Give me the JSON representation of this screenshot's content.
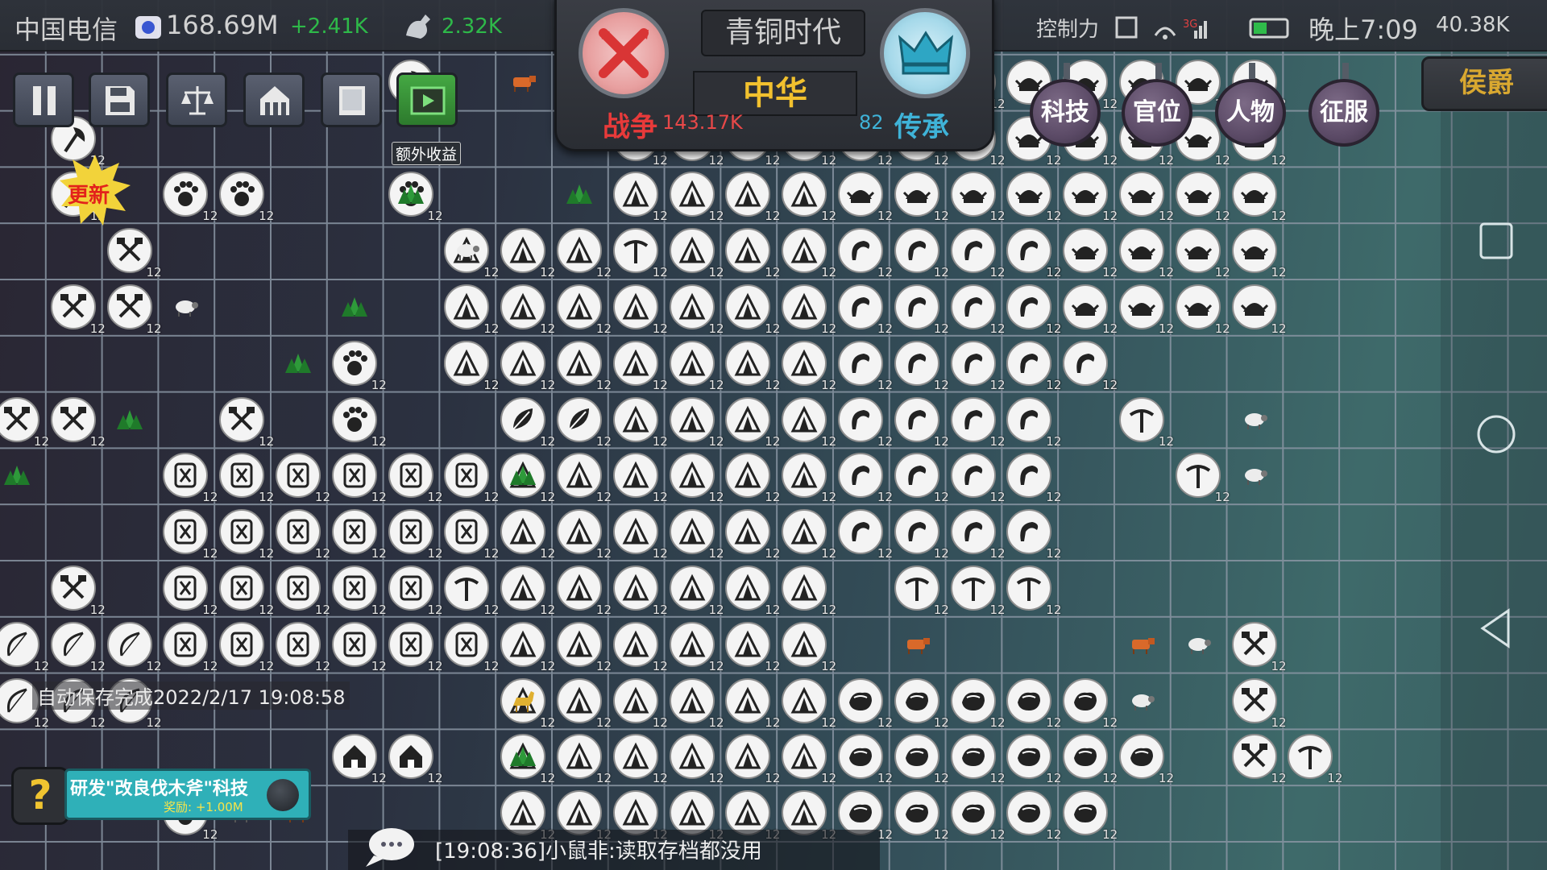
{
  "status_bar": {
    "carrier": "中国电信",
    "gold": "168.69M",
    "gold_rate": "+2.41K",
    "strength": "2.32K",
    "control_label": "控制力",
    "clock": "晚上7:09",
    "right_value": "40.38K"
  },
  "banner": {
    "era": "青铜时代",
    "civilization": "中华",
    "war_label": "战争",
    "war_value": "143.17K",
    "heritage_value": "82",
    "heritage_label": "传承"
  },
  "toolbar": {
    "extra_income_label": "额外收益"
  },
  "menu": {
    "tech": "科技",
    "office": "官位",
    "people": "人物",
    "conquer": "征服",
    "rank": "侯爵"
  },
  "update_badge": "更新",
  "autosave": "自动保存完成2022/2/17 19:08:58",
  "quest": {
    "help": "?",
    "title": "研发\"改良伐木斧\"科技",
    "reward": "奖励: +1.00M"
  },
  "chat": {
    "message": "[19:08:36]小鼠非:读取存档都没用"
  },
  "tile_level": "12",
  "colors": {
    "war": "#e83a3a",
    "heritage": "#3fb3d8",
    "gold_text": "#f2c12e",
    "rank": "#d9a830",
    "quest": "#2fb0b8"
  },
  "icons": [
    "pause-icon",
    "save-icon",
    "scale-icon",
    "house-icon",
    "book-icon",
    "video-icon",
    "axe-icon",
    "paw-icon",
    "tent-icon",
    "pickaxe-icon",
    "crossed-tools-icon",
    "helmet-icon",
    "sickle-icon",
    "stone-icon",
    "bow-icon",
    "wheat-icon",
    "shield-icon",
    "leaf-icon",
    "tree-icon",
    "sheep-icon",
    "cow-icon",
    "horse-icon",
    "crown-icon",
    "crossed-swords-icon",
    "chat-icon"
  ]
}
